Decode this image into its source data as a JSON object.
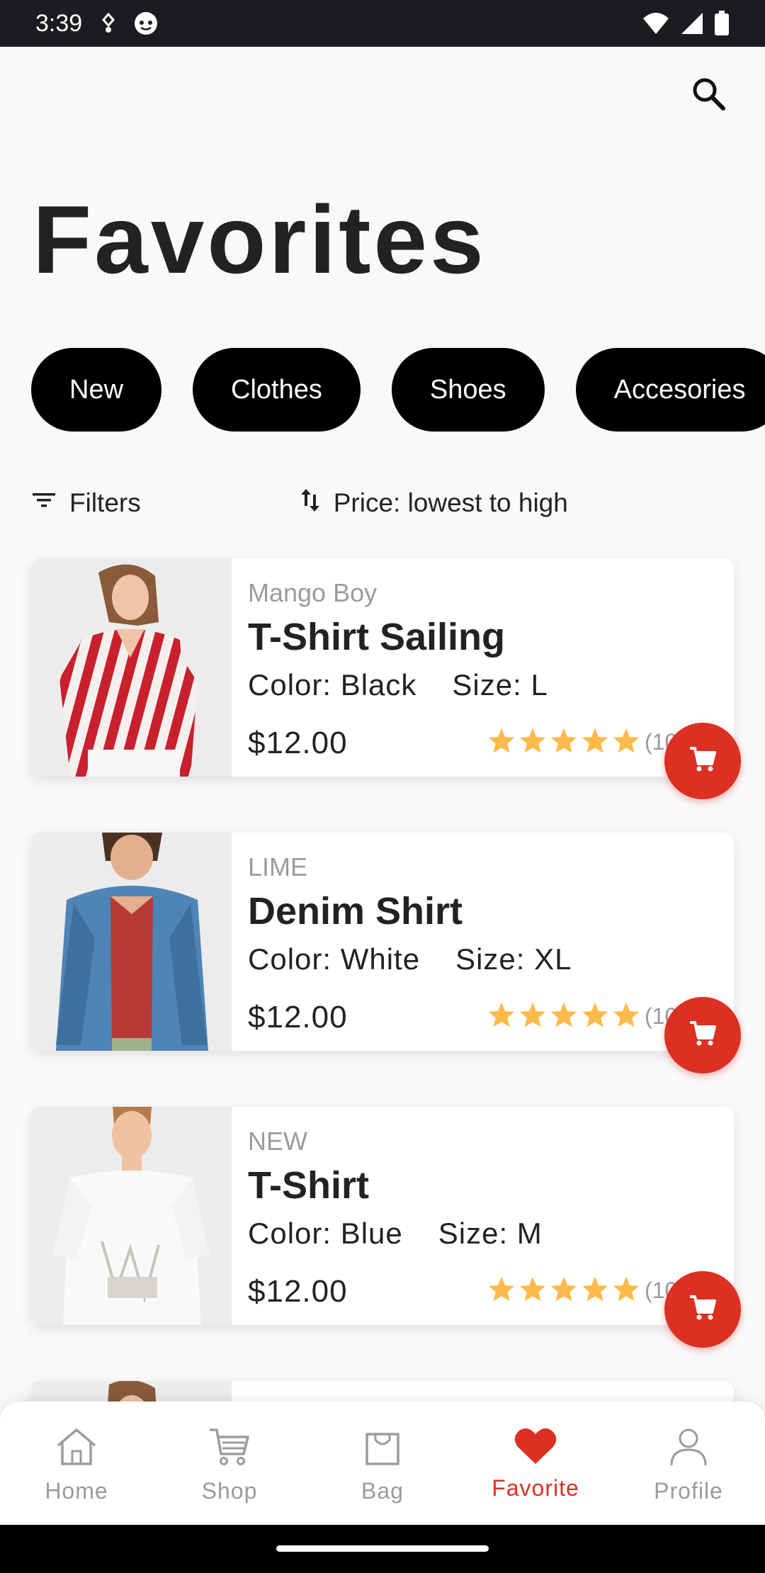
{
  "status_bar": {
    "time": "3:39"
  },
  "header": {
    "title": "Favorites"
  },
  "chips": [
    "New",
    "Clothes",
    "Shoes",
    "Accesories"
  ],
  "toolbar": {
    "filters_label": "Filters",
    "sort_label": "Price: lowest to high"
  },
  "products": [
    {
      "brand": "Mango Boy",
      "name": "T-Shirt Sailing",
      "color": "Color: Black",
      "size": "Size: L",
      "price": "$12.00",
      "rating": 5,
      "reviews": "(10)"
    },
    {
      "brand": "LIME",
      "name": "Denim Shirt",
      "color": "Color: White",
      "size": "Size: XL",
      "price": "$12.00",
      "rating": 5,
      "reviews": "(10)"
    },
    {
      "brand": "NEW",
      "name": "T-Shirt",
      "color": "Color: Blue",
      "size": "Size: M",
      "price": "$12.00",
      "rating": 5,
      "reviews": "(10)"
    }
  ],
  "nav": {
    "items": [
      {
        "label": "Home",
        "icon": "home-icon"
      },
      {
        "label": "Shop",
        "icon": "cart-icon"
      },
      {
        "label": "Bag",
        "icon": "bag-icon"
      },
      {
        "label": "Favorite",
        "icon": "heart-icon"
      },
      {
        "label": "Profile",
        "icon": "profile-icon"
      }
    ],
    "active": "Favorite"
  },
  "colors": {
    "accent": "#DB3022",
    "star": "#FFBA49",
    "chip_bg": "#000000",
    "muted": "#9B9B9B"
  }
}
